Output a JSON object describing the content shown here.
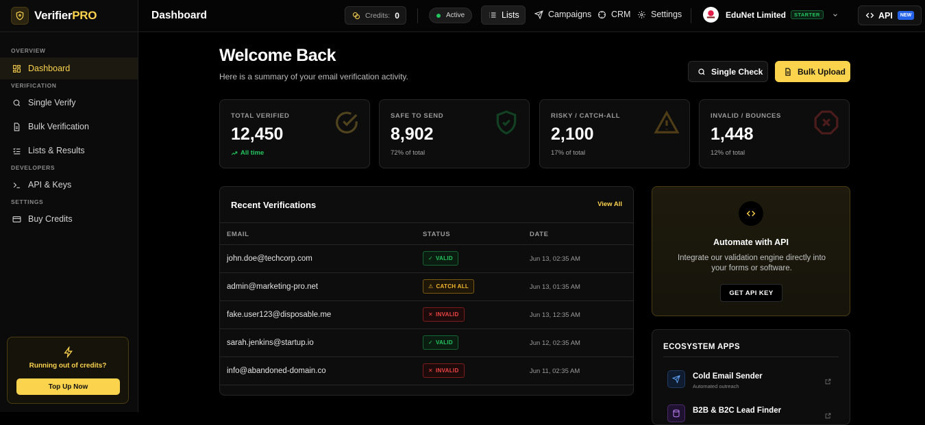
{
  "brand": {
    "name_main": "Verifier",
    "name_accent": "PRO"
  },
  "sidebar": {
    "sections": [
      "OVERVIEW",
      "VERIFICATION",
      "DEVELOPERS",
      "SETTINGS"
    ],
    "items": [
      {
        "label": "Dashboard",
        "icon": "grid-icon"
      },
      {
        "label": "Single Verify",
        "icon": "search-icon"
      },
      {
        "label": "Bulk Verification",
        "icon": "file-icon"
      },
      {
        "label": "Lists & Results",
        "icon": "list-check-icon"
      },
      {
        "label": "API & Keys",
        "icon": "terminal-icon"
      },
      {
        "label": "Buy Credits",
        "icon": "credit-card-icon"
      }
    ],
    "credit_box": {
      "title": "Running out of credits?",
      "button": "Top Up Now"
    }
  },
  "header": {
    "title": "Dashboard",
    "credits_label": "Credits:",
    "credits_value": "0",
    "status": "Active",
    "nav": [
      "Lists",
      "Campaigns",
      "CRM",
      "Settings"
    ],
    "company": "EduNet Limited",
    "plan": "STARTER",
    "api_label": "API",
    "new_badge": "NEW"
  },
  "main": {
    "welcome": "Welcome Back",
    "subtitle": "Here is a summary of your email verification activity.",
    "single_check": "Single Check",
    "bulk_upload": "Bulk Upload"
  },
  "stats": [
    {
      "label": "TOTAL VERIFIED",
      "value": "12,450",
      "note": "All time",
      "color": "#fcd34d"
    },
    {
      "label": "SAFE TO SEND",
      "value": "8,902",
      "note": "72% of total",
      "color": "#22c55e"
    },
    {
      "label": "RISKY / CATCH-ALL",
      "value": "2,100",
      "note": "17% of total",
      "color": "#f5b82e"
    },
    {
      "label": "INVALID / BOUNCES",
      "value": "1,448",
      "note": "12% of total",
      "color": "#ef4444"
    }
  ],
  "recent": {
    "title": "Recent Verifications",
    "view_all": "View All",
    "columns": [
      "EMAIL",
      "STATUS",
      "DATE"
    ],
    "rows": [
      {
        "email": "john.doe@techcorp.com",
        "status": "VALID",
        "date": "Jun 13, 02:35 AM"
      },
      {
        "email": "admin@marketing-pro.net",
        "status": "CATCH ALL",
        "date": "Jun 13, 01:35 AM"
      },
      {
        "email": "fake.user123@disposable.me",
        "status": "INVALID",
        "date": "Jun 13, 12:35 AM"
      },
      {
        "email": "sarah.jenkins@startup.io",
        "status": "VALID",
        "date": "Jun 12, 02:35 AM"
      },
      {
        "email": "info@abandoned-domain.co",
        "status": "INVALID",
        "date": "Jun 11, 02:35 AM"
      }
    ]
  },
  "automate": {
    "title": "Automate with API",
    "description": "Integrate our validation engine directly into your forms or software.",
    "button": "GET API KEY"
  },
  "ecosystem": {
    "title": "ECOSYSTEM APPS",
    "apps": [
      {
        "name": "Cold Email Sender",
        "sub": "Automated outreach"
      },
      {
        "name": "B2B & B2C Lead Finder",
        "sub": ""
      }
    ]
  }
}
